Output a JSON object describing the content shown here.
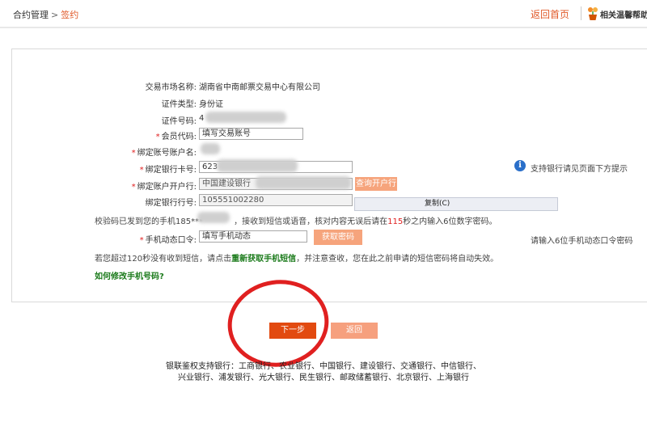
{
  "breadcrumb": {
    "root": "合约管理",
    "separator": ">",
    "current": "签约"
  },
  "header": {
    "home_label": "返回首页",
    "help_label": "相关温馨帮助"
  },
  "form": {
    "market_name_label": "交易市场名称:",
    "market_name_value": "湖南省中南邮票交易中心有限公司",
    "id_type_label": "证件类型:",
    "id_type_value": "身份证",
    "id_number_label": "证件号码:",
    "id_number_value": "4",
    "member_code_label": "会员代码:",
    "member_code_value": "填写交易账号",
    "account_name_label": "绑定账号账户名:",
    "card_number_label": "绑定银行卡号:",
    "card_number_value": "623",
    "bank_branch_label": "绑定账户开户行:",
    "bank_branch_value": "中国建设银行",
    "query_branch_button": "查询开户行",
    "bank_code_label": "绑定银行行号:",
    "bank_code_value": "105551002280",
    "copy_button": "复制(C)",
    "support_hint": "支持银行请见页面下方提示",
    "sms_notice_prefix": "校验码已发到您的手机185***",
    "sms_notice_middle": "，接收到短信或语音，核对内容无误后请在",
    "sms_seconds": "115",
    "sms_notice_suffix": "秒之内输入6位数字密码。",
    "dynamic_code_label": "手机动态口令:",
    "dynamic_code_value": "填写手机动态",
    "get_code_button": "获取密码",
    "dynamic_code_hint": "请输入6位手机动态口令密码",
    "resend_prefix": "若您超过120秒没有收到短信，请点击",
    "resend_link": "重新获取手机短信",
    "resend_suffix": "，并注意查收，您在此之前申请的短信密码将自动失效。",
    "change_phone_link": "如何修改手机号码?"
  },
  "actions": {
    "next_label": "下一步",
    "back_label": "返回"
  },
  "banks_notice": {
    "line1": "银联鉴权支持银行：工商银行、农业银行、中国银行、建设银行、交通银行、中信银行、",
    "line2": "兴业银行、浦发银行、光大银行、民生银行、邮政储蓄银行、北京银行、上海银行"
  },
  "colors": {
    "accent": "#e05a2a",
    "primary_button": "#e24a10",
    "secondary_button": "#f6a07e",
    "annotation": "#e02020"
  }
}
